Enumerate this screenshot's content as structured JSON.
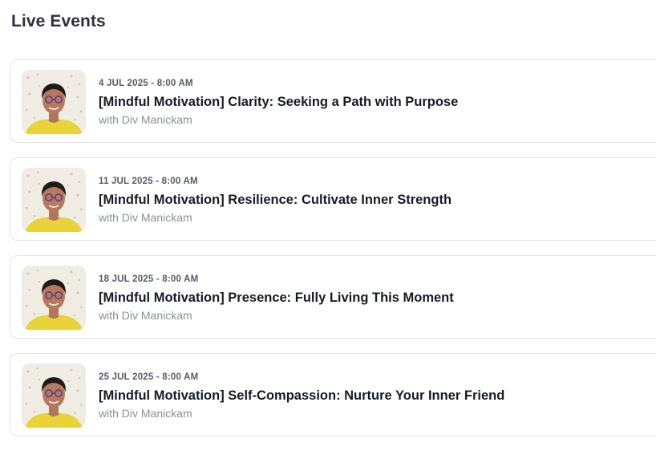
{
  "page": {
    "section_title": "Live Events"
  },
  "events": [
    {
      "date": "4 JUL 2025 - 8:00 AM",
      "title": "[Mindful Motivation] Clarity: Seeking a Path with Purpose",
      "host": "with Div Manickam"
    },
    {
      "date": "11 JUL 2025 - 8:00 AM",
      "title": "[Mindful Motivation] Resilience: Cultivate Inner Strength",
      "host": "with Div Manickam"
    },
    {
      "date": "18 JUL 2025 - 8:00 AM",
      "title": "[Mindful Motivation] Presence: Fully Living This Moment",
      "host": "with Div Manickam"
    },
    {
      "date": "25 JUL 2025 - 8:00 AM",
      "title": "[Mindful Motivation] Self-Compassion: Nurture Your Inner Friend",
      "host": "with Div Manickam"
    }
  ],
  "colors": {
    "card_border": "#e3e5ea",
    "title_text": "#161b26",
    "date_text": "#555b66",
    "host_text": "#8a8f99",
    "shirt": "#e8d33a"
  }
}
